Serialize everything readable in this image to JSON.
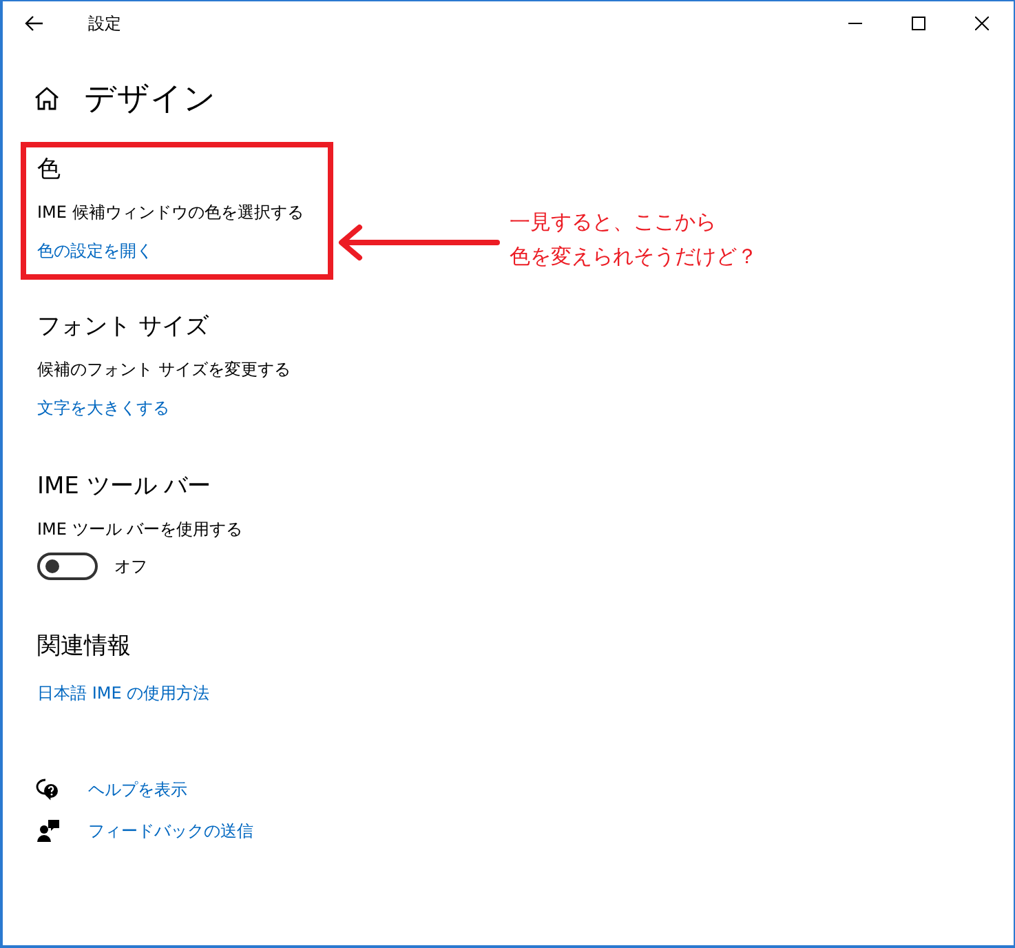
{
  "window": {
    "title": "設定"
  },
  "page": {
    "title": "デザイン"
  },
  "sections": [
    {
      "heading": "色",
      "highlighted": true,
      "items": [
        {
          "kind": "text",
          "text": "IME 候補ウィンドウの色を選択する"
        },
        {
          "kind": "link",
          "text": "色の設定を開く"
        }
      ]
    },
    {
      "heading": "フォント サイズ",
      "highlighted": false,
      "items": [
        {
          "kind": "text",
          "text": "候補のフォント サイズを変更する"
        },
        {
          "kind": "link",
          "text": "文字を大きくする"
        }
      ]
    },
    {
      "heading": "IME ツール バー",
      "highlighted": false,
      "items": [
        {
          "kind": "text",
          "text": "IME ツール バーを使用する"
        },
        {
          "kind": "toggle",
          "on": false,
          "text": "オフ"
        }
      ]
    },
    {
      "heading": "関連情報",
      "highlighted": false,
      "items": [
        {
          "kind": "link",
          "text": "日本語 IME の使用方法"
        }
      ]
    }
  ],
  "footer_links": [
    {
      "kind": "help",
      "text": "ヘルプを表示"
    },
    {
      "kind": "feedback",
      "text": "フィードバックの送信"
    }
  ],
  "annotation": {
    "lines": [
      "一見すると、ここから",
      "色を変えられそうだけど？"
    ]
  }
}
